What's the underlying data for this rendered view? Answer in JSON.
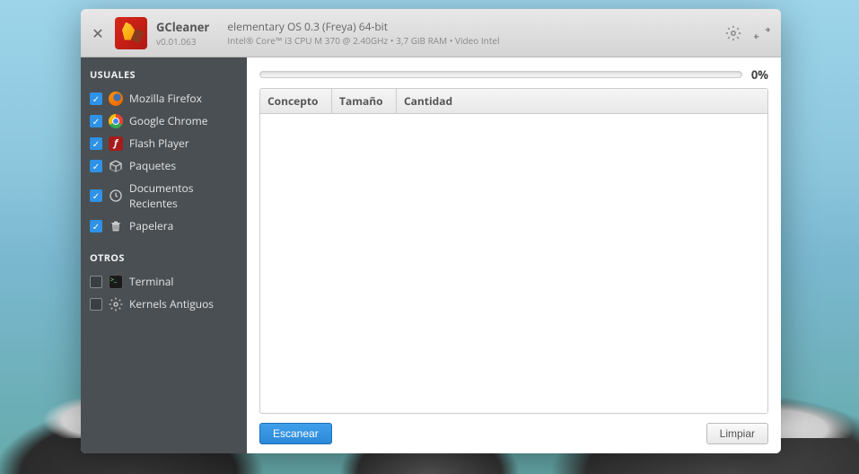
{
  "app": {
    "name": "GCleaner",
    "version": "v0.01.063",
    "os": "elementary OS 0.3 (Freya) 64-bit",
    "hw": "Intel® Core™ i3 CPU       M 370  @ 2.40GHz  •  3,7 GiB RAM  •  Video Intel"
  },
  "sidebar": {
    "sections": [
      {
        "title": "USUALES",
        "items": [
          {
            "label": "Mozilla Firefox",
            "checked": true,
            "icon": "firefox"
          },
          {
            "label": "Google Chrome",
            "checked": true,
            "icon": "chrome"
          },
          {
            "label": "Flash Player",
            "checked": true,
            "icon": "flash"
          },
          {
            "label": "Paquetes",
            "checked": true,
            "icon": "pkg"
          },
          {
            "label": "Documentos Recientes",
            "checked": true,
            "icon": "docs"
          },
          {
            "label": "Papelera",
            "checked": true,
            "icon": "trash"
          }
        ]
      },
      {
        "title": "OTROS",
        "items": [
          {
            "label": "Terminal",
            "checked": false,
            "icon": "term"
          },
          {
            "label": "Kernels Antiguos",
            "checked": false,
            "icon": "kernel"
          }
        ]
      }
    ]
  },
  "progress": {
    "percent": "0%"
  },
  "table": {
    "headers": [
      "Concepto",
      "Tamaño",
      "Cantidad"
    ],
    "rows": []
  },
  "buttons": {
    "scan": "Escanear",
    "clean": "Limpiar"
  }
}
